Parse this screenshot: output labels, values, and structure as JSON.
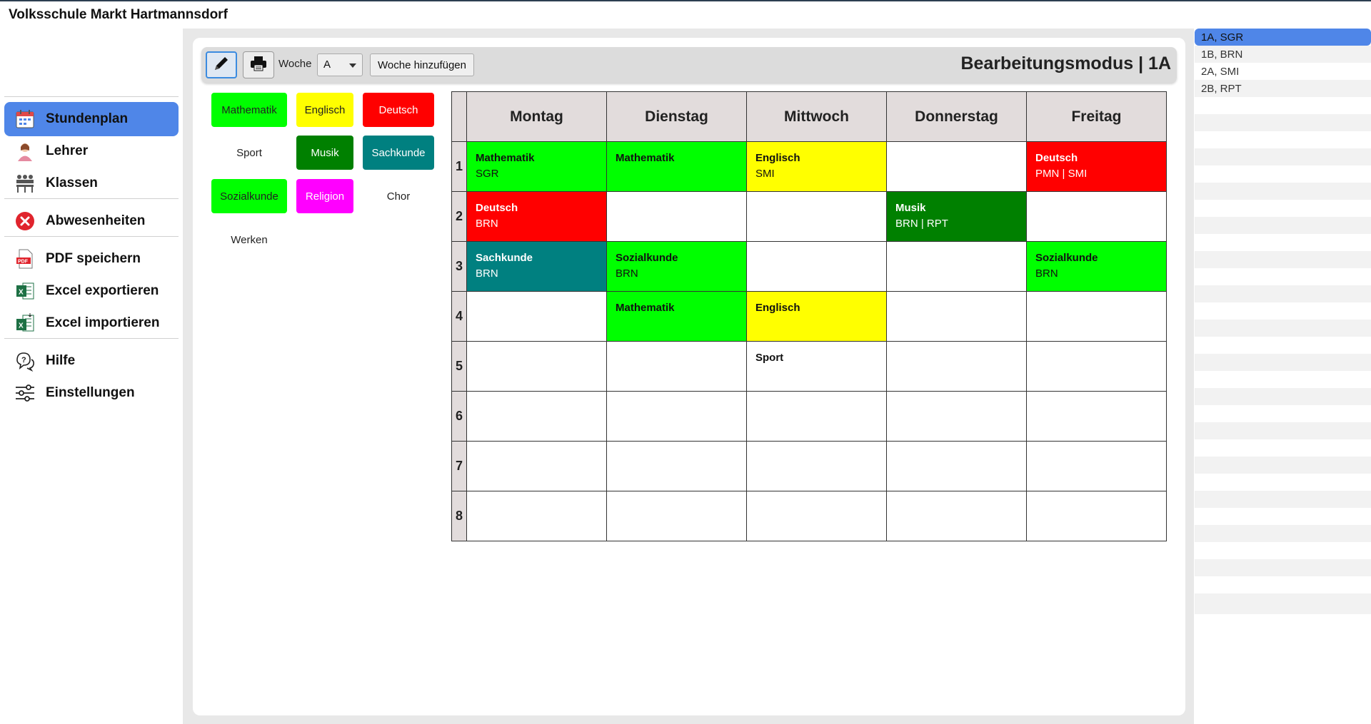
{
  "app": {
    "title": "Volksschule Markt Hartmannsdorf"
  },
  "nav": [
    {
      "label": "Stundenplan",
      "icon": "calendar-icon",
      "active": true
    },
    {
      "label": "Lehrer",
      "icon": "teacher-icon",
      "active": false
    },
    {
      "label": "Klassen",
      "icon": "classroom-icon",
      "active": false
    },
    {
      "label": "Abwesenheiten",
      "icon": "absence-x-icon",
      "active": false
    },
    {
      "label": "PDF speichern",
      "icon": "pdf-icon",
      "active": false
    },
    {
      "label": "Excel exportieren",
      "icon": "excel-export-icon",
      "active": false
    },
    {
      "label": "Excel importieren",
      "icon": "excel-import-icon",
      "active": false
    },
    {
      "label": "Hilfe",
      "icon": "help-icon",
      "active": false
    },
    {
      "label": "Einstellungen",
      "icon": "settings-sliders-icon",
      "active": false
    }
  ],
  "toolbar": {
    "week_label": "Woche",
    "week_value": "A",
    "add_week_label": "Woche hinzufügen",
    "mode_title": "Bearbeitungsmodus | 1A"
  },
  "subjects": [
    {
      "name": "Mathematik",
      "bg": "#00ff00",
      "fg": "#222222"
    },
    {
      "name": "Englisch",
      "bg": "#ffff00",
      "fg": "#222222"
    },
    {
      "name": "Deutsch",
      "bg": "#ff0000",
      "fg": "#ffffff"
    },
    {
      "name": "Sport",
      "bg": "#ffffff",
      "fg": "#222222"
    },
    {
      "name": "Musik",
      "bg": "#008000",
      "fg": "#ffffff"
    },
    {
      "name": "Sachkunde",
      "bg": "#008080",
      "fg": "#ffffff"
    },
    {
      "name": "Sozialkunde",
      "bg": "#00ff00",
      "fg": "#222222"
    },
    {
      "name": "Religion",
      "bg": "#ff00ff",
      "fg": "#ffffff"
    },
    {
      "name": "Chor",
      "bg": "#ffffff",
      "fg": "#222222"
    },
    {
      "name": "Werken",
      "bg": "#ffffff",
      "fg": "#222222"
    }
  ],
  "timetable": {
    "days": [
      "Montag",
      "Dienstag",
      "Mittwoch",
      "Donnerstag",
      "Freitag"
    ],
    "periods": [
      "1",
      "2",
      "3",
      "4",
      "5",
      "6",
      "7",
      "8"
    ],
    "rows": [
      [
        {
          "subject": "Mathematik",
          "teacher": "SGR",
          "bg": "#00ff00",
          "fg": "#111111"
        },
        {
          "subject": "Mathematik",
          "teacher": "",
          "bg": "#00ff00",
          "fg": "#111111"
        },
        {
          "subject": "Englisch",
          "teacher": "SMI",
          "bg": "#ffff00",
          "fg": "#111111"
        },
        {
          "subject": "",
          "teacher": "",
          "bg": "#ffffff",
          "fg": "#111111"
        },
        {
          "subject": "Deutsch",
          "teacher": "PMN | SMI",
          "bg": "#ff0000",
          "fg": "#ffffff"
        }
      ],
      [
        {
          "subject": "Deutsch",
          "teacher": "BRN",
          "bg": "#ff0000",
          "fg": "#ffffff"
        },
        {
          "subject": "",
          "teacher": "",
          "bg": "#ffffff",
          "fg": "#111111"
        },
        {
          "subject": "",
          "teacher": "",
          "bg": "#ffffff",
          "fg": "#111111"
        },
        {
          "subject": "Musik",
          "teacher": "BRN | RPT",
          "bg": "#008000",
          "fg": "#ffffff"
        },
        {
          "subject": "",
          "teacher": "",
          "bg": "#ffffff",
          "fg": "#111111"
        }
      ],
      [
        {
          "subject": "Sachkunde",
          "teacher": "BRN",
          "bg": "#008080",
          "fg": "#ffffff"
        },
        {
          "subject": "Sozialkunde",
          "teacher": "BRN",
          "bg": "#00ff00",
          "fg": "#111111"
        },
        {
          "subject": "",
          "teacher": "",
          "bg": "#ffffff",
          "fg": "#111111"
        },
        {
          "subject": "",
          "teacher": "",
          "bg": "#ffffff",
          "fg": "#111111"
        },
        {
          "subject": "Sozialkunde",
          "teacher": "BRN",
          "bg": "#00ff00",
          "fg": "#111111"
        }
      ],
      [
        {
          "subject": "",
          "teacher": "",
          "bg": "#ffffff",
          "fg": "#111111"
        },
        {
          "subject": "Mathematik",
          "teacher": "",
          "bg": "#00ff00",
          "fg": "#111111"
        },
        {
          "subject": "Englisch",
          "teacher": "",
          "bg": "#ffff00",
          "fg": "#111111"
        },
        {
          "subject": "",
          "teacher": "",
          "bg": "#ffffff",
          "fg": "#111111"
        },
        {
          "subject": "",
          "teacher": "",
          "bg": "#ffffff",
          "fg": "#111111"
        }
      ],
      [
        {
          "subject": "",
          "teacher": "",
          "bg": "#ffffff",
          "fg": "#111111"
        },
        {
          "subject": "",
          "teacher": "",
          "bg": "#ffffff",
          "fg": "#111111"
        },
        {
          "subject": "Sport",
          "teacher": "",
          "bg": "#ffffff",
          "fg": "#111111"
        },
        {
          "subject": "",
          "teacher": "",
          "bg": "#ffffff",
          "fg": "#111111"
        },
        {
          "subject": "",
          "teacher": "",
          "bg": "#ffffff",
          "fg": "#111111"
        }
      ],
      [
        {
          "subject": "",
          "teacher": "",
          "bg": "#ffffff",
          "fg": "#111111"
        },
        {
          "subject": "",
          "teacher": "",
          "bg": "#ffffff",
          "fg": "#111111"
        },
        {
          "subject": "",
          "teacher": "",
          "bg": "#ffffff",
          "fg": "#111111"
        },
        {
          "subject": "",
          "teacher": "",
          "bg": "#ffffff",
          "fg": "#111111"
        },
        {
          "subject": "",
          "teacher": "",
          "bg": "#ffffff",
          "fg": "#111111"
        }
      ],
      [
        {
          "subject": "",
          "teacher": "",
          "bg": "#ffffff",
          "fg": "#111111"
        },
        {
          "subject": "",
          "teacher": "",
          "bg": "#ffffff",
          "fg": "#111111"
        },
        {
          "subject": "",
          "teacher": "",
          "bg": "#ffffff",
          "fg": "#111111"
        },
        {
          "subject": "",
          "teacher": "",
          "bg": "#ffffff",
          "fg": "#111111"
        },
        {
          "subject": "",
          "teacher": "",
          "bg": "#ffffff",
          "fg": "#111111"
        }
      ],
      [
        {
          "subject": "",
          "teacher": "",
          "bg": "#ffffff",
          "fg": "#111111"
        },
        {
          "subject": "",
          "teacher": "",
          "bg": "#ffffff",
          "fg": "#111111"
        },
        {
          "subject": "",
          "teacher": "",
          "bg": "#ffffff",
          "fg": "#111111"
        },
        {
          "subject": "",
          "teacher": "",
          "bg": "#ffffff",
          "fg": "#111111"
        },
        {
          "subject": "",
          "teacher": "",
          "bg": "#ffffff",
          "fg": "#111111"
        }
      ]
    ]
  },
  "classes": [
    {
      "label": "1A, SGR",
      "selected": true
    },
    {
      "label": "1B, BRN",
      "selected": false
    },
    {
      "label": "2A, SMI",
      "selected": false
    },
    {
      "label": "2B, RPT",
      "selected": false
    }
  ],
  "colors": {
    "accent": "#4f86e8",
    "header_bg": "#e2dcdc",
    "main_bg": "#e8e8e8"
  }
}
